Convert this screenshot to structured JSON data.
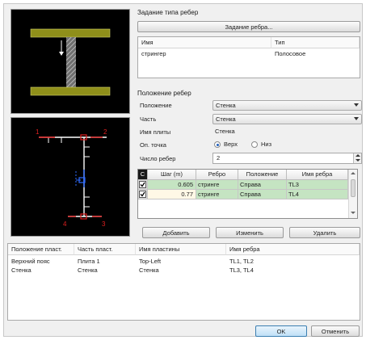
{
  "rib_type": {
    "group_title": "Задание типа ребер",
    "button_label": "Задание ребра...",
    "columns": [
      "Имя",
      "Тип"
    ],
    "rows": [
      {
        "name": "стрингер",
        "type": "Полосовое"
      }
    ]
  },
  "rib_position": {
    "group_title": "Положение ребер",
    "position_label": "Положение",
    "position_value": "Стенка",
    "part_label": "Часть",
    "part_value": "Стенка",
    "plate_name_label": "Имя плиты",
    "plate_name_value": "Стенка",
    "ref_point_label": "Оп. точка",
    "ref_point_options": [
      "Верх",
      "Низ"
    ],
    "ref_point_selected": "Верх",
    "rib_count_label": "Число ребер",
    "rib_count_value": "2"
  },
  "rib_grid": {
    "corner_label": "С",
    "columns": [
      "Шаг (m)",
      "Ребро",
      "Положение",
      "Имя ребра"
    ],
    "rows": [
      {
        "step": "0.605",
        "rib": "стринге",
        "position": "Справа",
        "name": "TL3"
      },
      {
        "step": "0.77",
        "rib": "стринге",
        "position": "Справа",
        "name": "TL4"
      }
    ]
  },
  "grid_buttons": {
    "add": "Добавить",
    "edit": "Изменить",
    "delete": "Удалить"
  },
  "summary": {
    "columns": [
      "Положение пласт.",
      "Часть пласт.",
      "Имя пластины",
      "Имя ребра"
    ],
    "rows": [
      {
        "position": "Верхний пояс",
        "part": "Плита 1",
        "plate": "Top-Left",
        "ribs": "TL1, TL2"
      },
      {
        "position": "Стенка",
        "part": "Стенка",
        "plate": "Стенка",
        "ribs": "TL3, TL4"
      }
    ]
  },
  "footer": {
    "ok": "OK",
    "cancel": "Отменить"
  },
  "preview": {
    "labels": [
      "1",
      "2",
      "3",
      "4"
    ]
  },
  "colors": {
    "flange": "#8f8f1a",
    "hatch": "#9a9a9a",
    "marker_red": "#e02020",
    "marker_blue": "#2e6bff",
    "grid_green": "#c5e4c2"
  }
}
